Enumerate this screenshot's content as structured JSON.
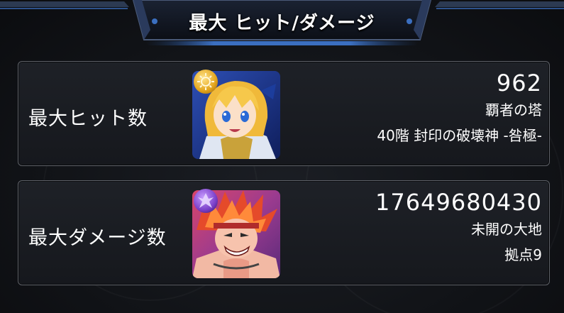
{
  "header": {
    "title": "最大 ヒット/ダメージ"
  },
  "max_hit": {
    "label": "最大ヒット数",
    "value": "962",
    "location_name": "覇者の塔",
    "floor_detail": "40階 封印の破壊神 -咎極-",
    "avatar_icon": "blonde-warrior-character-icon",
    "badge_icon": "gold-sun-element-icon",
    "badge_color": "#e3a51c"
  },
  "max_damage": {
    "label": "最大ダメージ数",
    "value": "17649680430",
    "location_name": "未開の大地",
    "floor_detail": "拠点9",
    "avatar_icon": "red-haired-fighter-character-icon",
    "badge_icon": "purple-dark-element-icon",
    "badge_color": "#7a3fc9"
  },
  "colors": {
    "background": "#111317",
    "panel_border": "#5e6168",
    "text": "#ffffff",
    "header_accent": "#3b6fc0"
  }
}
